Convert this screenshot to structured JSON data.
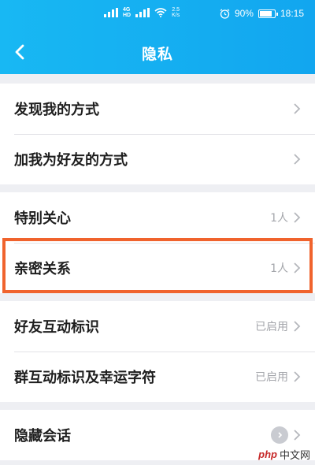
{
  "status_bar": {
    "network_speed": "2.5",
    "network_speed_unit": "K/s",
    "battery": "90%",
    "time": "18:15",
    "battery_level": 0.9
  },
  "nav": {
    "back_icon": "chevron-left-icon",
    "title": "隐私"
  },
  "groups": [
    {
      "items": [
        {
          "label": "发现我的方式",
          "value": ""
        },
        {
          "label": "加我为好友的方式",
          "value": ""
        }
      ]
    },
    {
      "items": [
        {
          "label": "特别关心",
          "value": "1人"
        },
        {
          "label": "亲密关系",
          "value": "1人",
          "highlighted": true
        }
      ]
    },
    {
      "items": [
        {
          "label": "好友互动标识",
          "value": "已启用"
        },
        {
          "label": "群互动标识及幸运字符",
          "value": "已启用"
        }
      ]
    },
    {
      "items": [
        {
          "label": "隐藏会话",
          "value": ""
        }
      ]
    }
  ],
  "colors": {
    "header": "#12a6ef",
    "highlight": "#f0632d",
    "background": "#eeeff3"
  },
  "watermark": {
    "logo": "php",
    "text": "中文网"
  }
}
